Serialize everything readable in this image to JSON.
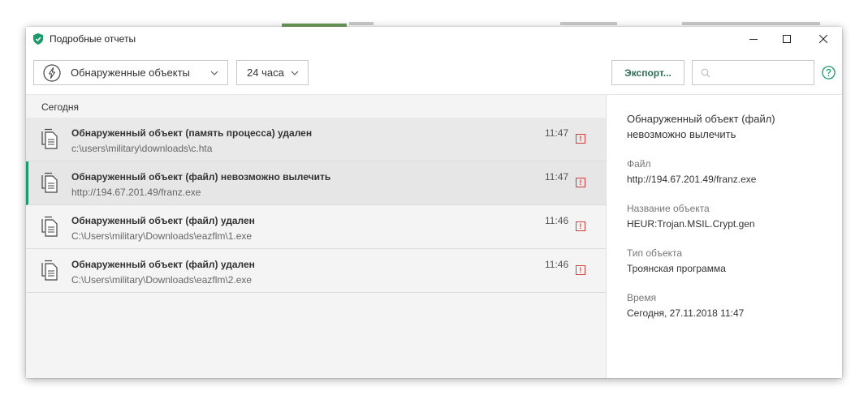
{
  "window": {
    "title": "Подробные отчеты"
  },
  "toolbar": {
    "objects_dropdown_label": "Обнаруженные объекты",
    "period_dropdown_label": "24 часа",
    "export_label": "Экспорт...",
    "search_value": "",
    "search_placeholder": ""
  },
  "list": {
    "group_label": "Сегодня",
    "rows": [
      {
        "title": "Обнаруженный объект (память процесса) удален",
        "path": "c:\\users\\military\\downloads\\c.hta",
        "time": "11:47",
        "warn": "!"
      },
      {
        "title": "Обнаруженный объект (файл) невозможно вылечить",
        "path": "http://194.67.201.49/franz.exe",
        "time": "11:47",
        "warn": "!"
      },
      {
        "title": "Обнаруженный объект (файл) удален",
        "path": "C:\\Users\\military\\Downloads\\eazflm\\1.exe",
        "time": "11:46",
        "warn": "!"
      },
      {
        "title": "Обнаруженный объект (файл) удален",
        "path": "C:\\Users\\military\\Downloads\\eazflm\\2.exe",
        "time": "11:46",
        "warn": "!"
      }
    ]
  },
  "details": {
    "title": "Обнаруженный объект (файл) невозможно вылечить",
    "file_label": "Файл",
    "file_value": "http://194.67.201.49/franz.exe",
    "object_name_label": "Название объекта",
    "object_name_value": "HEUR:Trojan.MSIL.Crypt.gen",
    "object_type_label": "Тип объекта",
    "object_type_value": "Троянская программа",
    "time_label": "Время",
    "time_value": "Сегодня, 27.11.2018 11:47"
  },
  "colors": {
    "accent": "#1d9a6c",
    "export_text": "#2d6e53",
    "warning": "#d23c3c"
  },
  "icons": {
    "app": "kaspersky-shield-icon",
    "objects_dropdown": "lightning-circle-icon",
    "row": "file-copy-icon",
    "search": "search-icon",
    "help": "help-circle-icon"
  }
}
